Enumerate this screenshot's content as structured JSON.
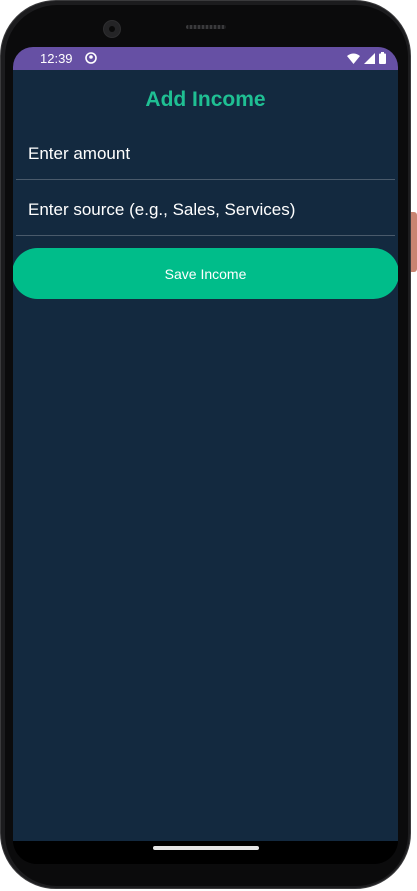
{
  "status_bar": {
    "time": "12:39",
    "app_icon": "notification-app-icon",
    "wifi_icon": "wifi-icon",
    "signal_icon": "cellular-signal-icon",
    "battery_icon": "battery-icon",
    "background_color": "#6650a4"
  },
  "page": {
    "title": "Add Income",
    "title_color": "#1fbf93",
    "background_color": "#13293f"
  },
  "form": {
    "amount_placeholder": "Enter amount",
    "amount_value": "",
    "source_placeholder": "Enter source (e.g., Sales, Services)",
    "source_value": "",
    "save_label": "Save Income",
    "save_color": "#00bd8a"
  }
}
